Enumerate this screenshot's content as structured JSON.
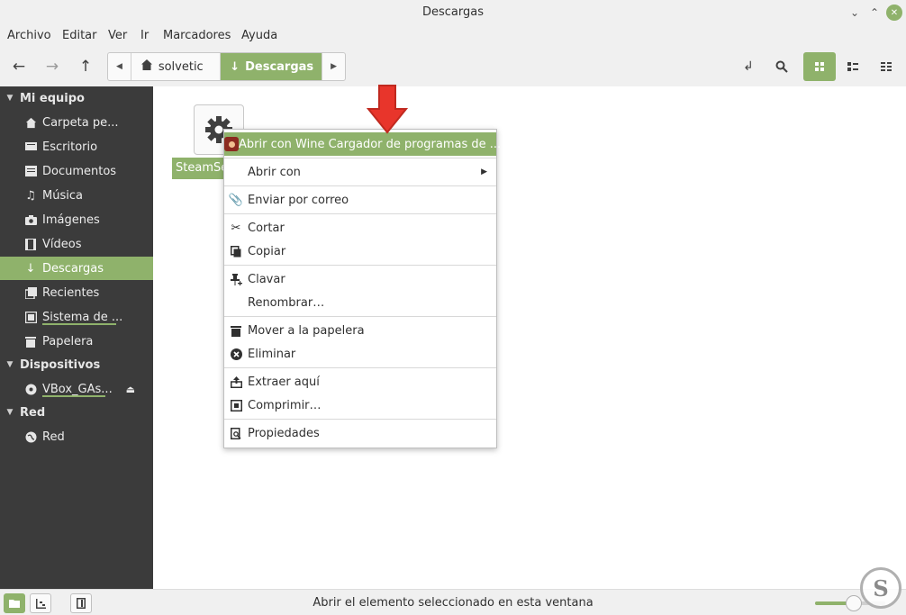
{
  "window": {
    "title": "Descargas"
  },
  "menubar": [
    "Archivo",
    "Editar",
    "Ver",
    "Ir",
    "Marcadores",
    "Ayuda"
  ],
  "pathbar": {
    "home": "solvetic",
    "current": "Descargas"
  },
  "sidebar": {
    "sections": [
      {
        "title": "Mi equipo",
        "items": [
          {
            "label": "Carpeta pe...",
            "icon": "home-icon"
          },
          {
            "label": "Escritorio",
            "icon": "desktop-icon"
          },
          {
            "label": "Documentos",
            "icon": "documents-icon"
          },
          {
            "label": "Música",
            "icon": "music-icon"
          },
          {
            "label": "Imágenes",
            "icon": "camera-icon"
          },
          {
            "label": "Vídeos",
            "icon": "film-icon"
          },
          {
            "label": "Descargas",
            "icon": "download-icon",
            "selected": true
          },
          {
            "label": "Recientes",
            "icon": "recent-icon"
          },
          {
            "label": "Sistema de ...",
            "icon": "drive-icon"
          },
          {
            "label": "Papelera",
            "icon": "trash-icon"
          }
        ]
      },
      {
        "title": "Dispositivos",
        "items": [
          {
            "label": "VBox_GAs...",
            "icon": "disc-icon"
          }
        ]
      },
      {
        "title": "Red",
        "items": [
          {
            "label": "Red",
            "icon": "network-icon"
          }
        ]
      }
    ]
  },
  "file": {
    "name": "SteamSetup.exe"
  },
  "context_menu": {
    "open_with_wine": "Abrir con Wine Cargador de programas de ...",
    "open_with": "Abrir con",
    "send_mail": "Enviar por correo",
    "cut": "Cortar",
    "copy": "Copiar",
    "pin": "Clavar",
    "rename": "Renombrar…",
    "move_trash": "Mover a la papelera",
    "delete": "Eliminar",
    "extract_here": "Extraer aquí",
    "compress": "Comprimir…",
    "properties": "Propiedades"
  },
  "status": {
    "text": "Abrir el elemento seleccionado en esta ventana",
    "zoom_level": 0.55
  },
  "colors": {
    "accent": "#8fb26b",
    "sidebar_bg": "#3b3b3b",
    "arrow": "#e8352b"
  }
}
